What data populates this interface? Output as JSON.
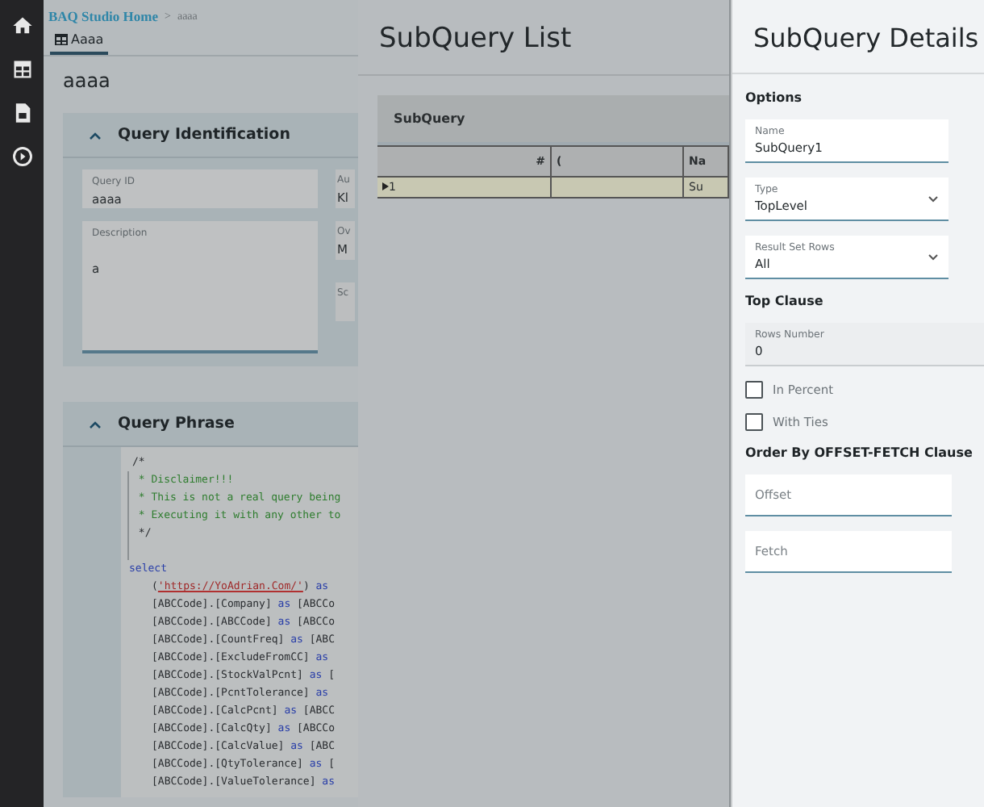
{
  "nav": {
    "items": [
      {
        "kind": "home"
      },
      {
        "kind": "grid"
      },
      {
        "kind": "report"
      },
      {
        "kind": "play"
      }
    ]
  },
  "breadcrumb": {
    "home": "BAQ Studio Home",
    "separator": ">",
    "current": "aaaa"
  },
  "tab": {
    "label": "Aaaa",
    "selected": true
  },
  "page_title": "aaaa",
  "query_identification": {
    "title": "Query Identification",
    "expanded": true,
    "fields": [
      {
        "label": "Query ID",
        "value": "aaaa"
      },
      {
        "label": "Description",
        "value": "a"
      }
    ],
    "side_fields": [
      {
        "label": "Au",
        "value": "Kl"
      },
      {
        "label": "Ov",
        "value": "M"
      },
      {
        "label": "Sc"
      }
    ]
  },
  "query_phrase": {
    "title": "Query Phrase",
    "expanded": true,
    "lines": [
      {
        "kind": "comment",
        "parts": [
          {
            "text": "/*",
            "kind": "plain"
          }
        ]
      },
      {
        "kind": "comment",
        "parts": [
          {
            "text": " * Disclaimer!!!",
            "kind": "comment"
          }
        ]
      },
      {
        "kind": "comment",
        "parts": [
          {
            "text": " * This is not a real query being",
            "kind": "comment"
          }
        ]
      },
      {
        "kind": "comment",
        "parts": [
          {
            "text": " * Executing it with any other to",
            "kind": "comment"
          }
        ]
      },
      {
        "kind": "comment",
        "parts": [
          {
            "text": " */",
            "kind": "plain"
          }
        ]
      },
      {
        "kind": "blank"
      },
      {
        "kind": "top",
        "parts": [
          {
            "text": "select",
            "kind": "keyword"
          }
        ]
      },
      {
        "kind": "field",
        "parts": [
          {
            "text": "(",
            "kind": "plain"
          },
          {
            "text": "'https://YoAdrian.Com/'",
            "kind": "string"
          },
          {
            "text": ") ",
            "kind": "plain"
          },
          {
            "text": "as",
            "kind": "keyword"
          }
        ]
      },
      {
        "kind": "field",
        "parts": [
          {
            "text": "[ABCCode].[Company] ",
            "kind": "plain"
          },
          {
            "text": "as",
            "kind": "keyword"
          },
          {
            "text": " [ABCCo",
            "kind": "plain"
          }
        ]
      },
      {
        "kind": "field",
        "parts": [
          {
            "text": "[ABCCode].[ABCCode] ",
            "kind": "plain"
          },
          {
            "text": "as",
            "kind": "keyword"
          },
          {
            "text": " [ABCCo",
            "kind": "plain"
          }
        ]
      },
      {
        "kind": "field",
        "parts": [
          {
            "text": "[ABCCode].[CountFreq] ",
            "kind": "plain"
          },
          {
            "text": "as",
            "kind": "keyword"
          },
          {
            "text": " [ABC",
            "kind": "plain"
          }
        ]
      },
      {
        "kind": "field",
        "parts": [
          {
            "text": "[ABCCode].[ExcludeFromCC] ",
            "kind": "plain"
          },
          {
            "text": "as",
            "kind": "keyword"
          }
        ]
      },
      {
        "kind": "field",
        "parts": [
          {
            "text": "[ABCCode].[StockValPcnt] ",
            "kind": "plain"
          },
          {
            "text": "as",
            "kind": "keyword"
          },
          {
            "text": " [",
            "kind": "plain"
          }
        ]
      },
      {
        "kind": "field",
        "parts": [
          {
            "text": "[ABCCode].[PcntTolerance] ",
            "kind": "plain"
          },
          {
            "text": "as",
            "kind": "keyword"
          }
        ]
      },
      {
        "kind": "field",
        "parts": [
          {
            "text": "[ABCCode].[CalcPcnt] ",
            "kind": "plain"
          },
          {
            "text": "as",
            "kind": "keyword"
          },
          {
            "text": " [ABCC",
            "kind": "plain"
          }
        ]
      },
      {
        "kind": "field",
        "parts": [
          {
            "text": "[ABCCode].[CalcQty] ",
            "kind": "plain"
          },
          {
            "text": "as",
            "kind": "keyword"
          },
          {
            "text": " [ABCCo",
            "kind": "plain"
          }
        ]
      },
      {
        "kind": "field",
        "parts": [
          {
            "text": "[ABCCode].[CalcValue] ",
            "kind": "plain"
          },
          {
            "text": "as",
            "kind": "keyword"
          },
          {
            "text": " [ABC",
            "kind": "plain"
          }
        ]
      },
      {
        "kind": "field",
        "parts": [
          {
            "text": "[ABCCode].[QtyTolerance] ",
            "kind": "plain"
          },
          {
            "text": "as",
            "kind": "keyword"
          },
          {
            "text": " [",
            "kind": "plain"
          }
        ]
      },
      {
        "kind": "field",
        "parts": [
          {
            "text": "[ABCCode].[ValueTolerance] ",
            "kind": "plain"
          },
          {
            "text": "as",
            "kind": "keyword"
          }
        ]
      }
    ]
  },
  "subquery_list": {
    "title": "SubQuery List",
    "grid_title": "SubQuery",
    "columns": [
      "#",
      "(",
      "Na"
    ],
    "rows": [
      {
        "selected": true,
        "cells": [
          "1",
          "",
          "Su"
        ]
      }
    ]
  },
  "subquery_details": {
    "title": "SubQuery Details",
    "sections": [
      {
        "title": "Options",
        "items": [
          {
            "kind": "text",
            "label": "Name",
            "value": "SubQuery1"
          },
          {
            "kind": "select",
            "label": "Type",
            "value": "TopLevel"
          },
          {
            "kind": "select",
            "label": "Result Set Rows",
            "value": "All"
          }
        ]
      },
      {
        "title": "Top Clause",
        "items": [
          {
            "kind": "readonly",
            "label": "Rows Number",
            "value": "0"
          },
          {
            "kind": "checkbox",
            "label": "In Percent",
            "checked": false
          },
          {
            "kind": "checkbox",
            "label": "With Ties",
            "checked": false
          }
        ]
      },
      {
        "title": "Order By OFFSET-FETCH Clause",
        "items": [
          {
            "kind": "input",
            "placeholder": "Offset"
          },
          {
            "kind": "input",
            "placeholder": "Fetch"
          }
        ]
      }
    ]
  }
}
